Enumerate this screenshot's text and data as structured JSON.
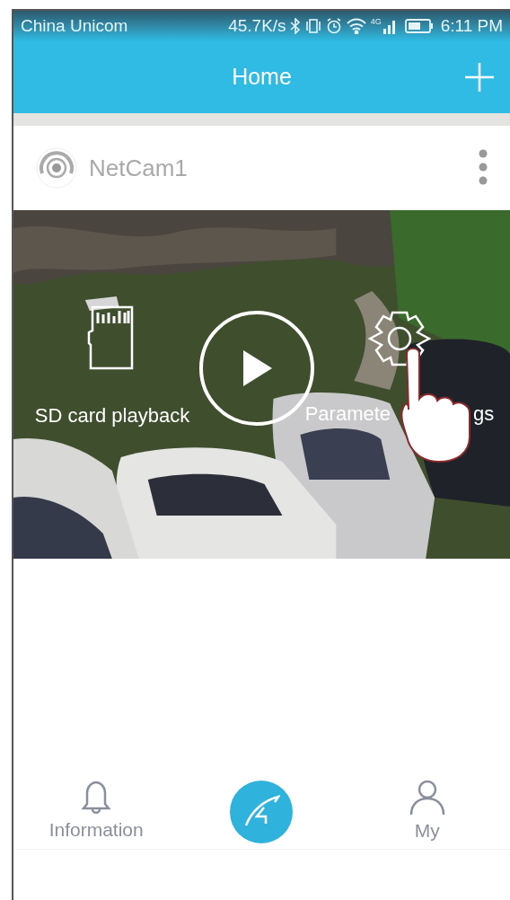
{
  "status_bar": {
    "carrier": "China Unicom",
    "speed": "45.7K/s",
    "network": "4G",
    "time": "6:11 PM"
  },
  "header": {
    "title": "Home"
  },
  "camera": {
    "name": "NetCam1",
    "actions": [
      {
        "kind": "sd",
        "label": "SD card playback"
      },
      {
        "kind": "settings",
        "label_before": "Paramete",
        "label_after": "gs"
      }
    ]
  },
  "tab_bar": {
    "items": [
      {
        "kind": "bell",
        "label": "Information"
      },
      {
        "kind": "center"
      },
      {
        "kind": "person",
        "label": "My"
      }
    ]
  }
}
